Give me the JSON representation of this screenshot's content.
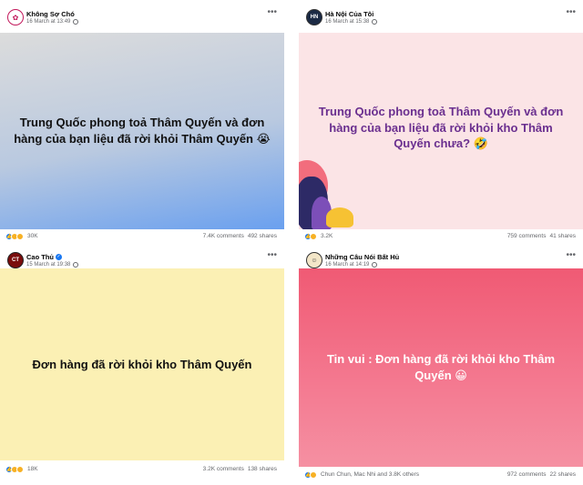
{
  "posts": [
    {
      "author": "Không Sợ Chó",
      "time": "16 March at 13:49",
      "text": "Trung Quốc phong toả Thâm Quyến và đơn hàng của bạn liệu đã rời khỏi Thâm Quyến 😭",
      "reaction_count": "30K",
      "comments": "7.4K comments",
      "shares": "492 shares",
      "colors": {
        "bg_from": "#dcdcdc",
        "bg_to": "#6aa0ef",
        "text": "#111111"
      },
      "reactions": [
        "like-icon",
        "haha-icon",
        "sad-icon"
      ]
    },
    {
      "author": "Hà Nội Của Tôi",
      "time": "16 March at 15:38",
      "text": "Trung Quốc phong toả Thâm Quyến và đơn hàng của bạn liệu đã rời khỏi kho Thâm Quyến chưa? 🤣",
      "reaction_count": "3.2K",
      "comments": "759 comments",
      "shares": "41 shares",
      "colors": {
        "bg": "#fbe4e6",
        "text": "#6a2f8f"
      },
      "reactions": [
        "like-icon",
        "haha-icon"
      ]
    },
    {
      "author": "Cao Thủ",
      "time": "15 March at 19:38",
      "text": "Đơn hàng đã rời khỏi kho Thâm Quyến",
      "reaction_count": "18K",
      "comments": "3.2K comments",
      "shares": "138 shares",
      "colors": {
        "bg": "#fbf0b4",
        "text": "#111111"
      },
      "reactions": [
        "like-icon",
        "haha-icon",
        "sad-icon"
      ]
    },
    {
      "author": "Những Câu Nói Bất Hủ",
      "time": "16 March at 14:19",
      "text": "Tin vui : Đơn hàng đã rời khỏi kho Thâm Quyến 😀",
      "reaction_count": "Chun Chun, Mac Nhi and 3.8K others",
      "comments": "972 comments",
      "shares": "22 shares",
      "colors": {
        "bg_from": "#f05a74",
        "bg_to": "#f590a2",
        "text": "#ffffff"
      },
      "reactions": [
        "like-icon",
        "haha-icon"
      ]
    }
  ]
}
